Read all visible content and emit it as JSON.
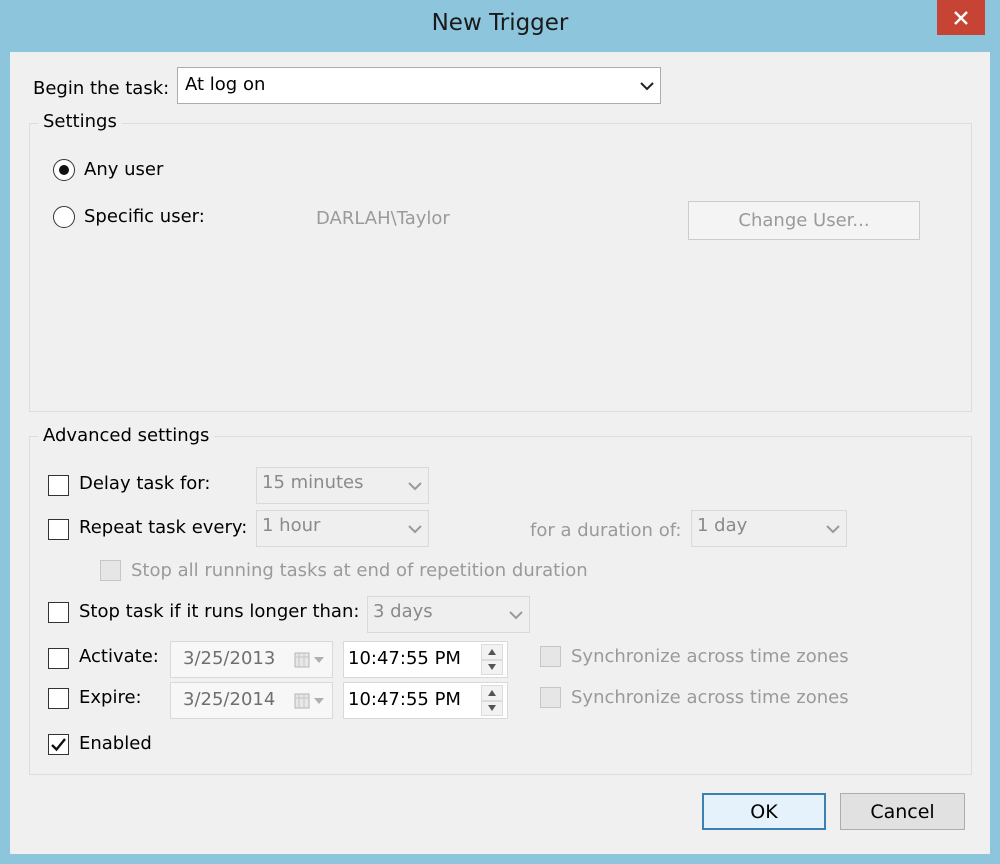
{
  "window": {
    "title": "New Trigger"
  },
  "begin": {
    "label": "Begin the task:",
    "value": "At log on"
  },
  "settings": {
    "legend": "Settings",
    "any_user_label": "Any user",
    "specific_user_label": "Specific user:",
    "user_value": "DARLAH\\Taylor",
    "change_user_label": "Change User..."
  },
  "advanced": {
    "legend": "Advanced settings",
    "delay_label": "Delay task for:",
    "delay_value": "15 minutes",
    "repeat_label": "Repeat task every:",
    "repeat_value": "1 hour",
    "duration_label": "for a duration of:",
    "duration_value": "1 day",
    "stop_all_label": "Stop all running tasks at end of repetition duration",
    "stop_longer_label": "Stop task if it runs longer than:",
    "stop_longer_value": "3 days",
    "activate_label": "Activate:",
    "activate_date": "3/25/2013",
    "activate_time": "10:47:55 PM",
    "expire_label": "Expire:",
    "expire_date": "3/25/2014",
    "expire_time": "10:47:55 PM",
    "sync_label": "Synchronize across time zones",
    "enabled_label": "Enabled"
  },
  "buttons": {
    "ok": "OK",
    "cancel": "Cancel"
  },
  "state": {
    "any_user": true,
    "specific_user": false,
    "delay": false,
    "repeat": false,
    "stop_all": false,
    "stop_longer": false,
    "activate": false,
    "expire": false,
    "sync_activate": false,
    "sync_expire": false,
    "enabled": true
  },
  "colors": {
    "frame": "#8cc5dc",
    "close": "#c74435",
    "client": "#f0f0f0",
    "default_button_border": "#3c7fb1"
  },
  "icons": [
    "close-icon",
    "chevron-down-icon",
    "calendar-icon",
    "spin-up-icon",
    "spin-down-icon",
    "checkmark-icon"
  ]
}
